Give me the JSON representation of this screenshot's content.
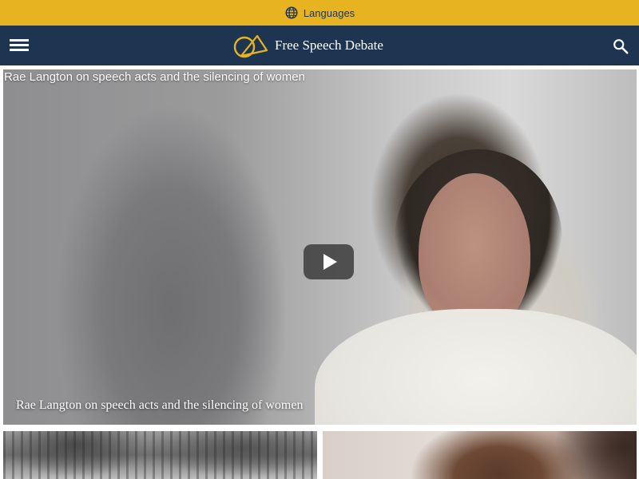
{
  "language_bar": {
    "label": "Languages",
    "icon": "globe-icon",
    "background": "#e8b321"
  },
  "header": {
    "site_title": "Free Speech Debate",
    "menu_icon": "menu-icon",
    "search_icon": "search-icon",
    "logo_icon": "free-speech-debate-logo",
    "background": "#1e3552",
    "accent": "#e8b321"
  },
  "featured_video": {
    "embedded_title": "Rae Langton on speech acts and the silencing of women",
    "caption": "Rae Langton on speech acts and the silencing of women",
    "play_icon": "play-icon"
  },
  "thumbnails": [
    {
      "name": "thumbnail-crowd"
    },
    {
      "name": "thumbnail-portrait"
    }
  ]
}
